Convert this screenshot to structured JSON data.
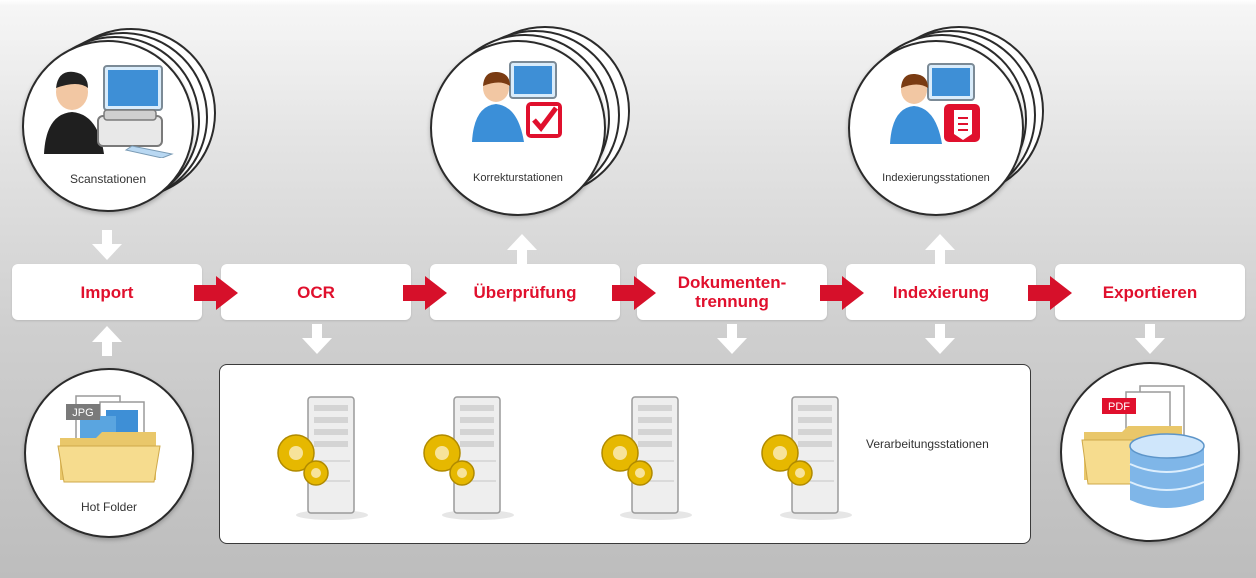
{
  "stations": {
    "scan": "Scanstationen",
    "correction": "Korrekturstationen",
    "indexing": "Indexierungsstationen",
    "hotfolder": "Hot Folder"
  },
  "steps": [
    {
      "label": "Import"
    },
    {
      "label": "OCR"
    },
    {
      "label": "Überprüfung"
    },
    {
      "label": "Dokumenten-\ntrennung"
    },
    {
      "label": "Indexierung"
    },
    {
      "label": "Exportieren"
    }
  ],
  "processing": {
    "label": "Verarbeitungsstationen",
    "server_count": 4
  },
  "badges": {
    "jpg": "JPG",
    "pdf": "PDF"
  },
  "colors": {
    "accent": "#e0102d",
    "arrow_red": "#d6102a",
    "arrow_white": "#ffffff",
    "gear": "#e6b800"
  },
  "icons": [
    "person-scanner-icon",
    "person-computer-check-icon",
    "person-computer-tag-icon",
    "folder-images-icon",
    "server-gears-icon",
    "database-documents-icon"
  ]
}
